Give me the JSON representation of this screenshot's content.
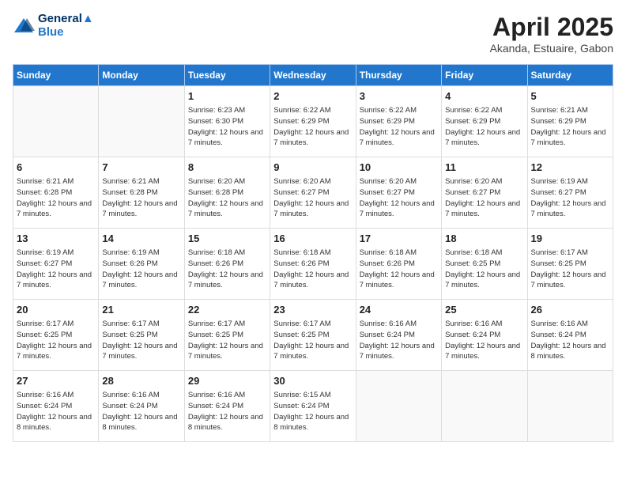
{
  "header": {
    "logo_line1": "General",
    "logo_line2": "Blue",
    "month_title": "April 2025",
    "location": "Akanda, Estuaire, Gabon"
  },
  "weekdays": [
    "Sunday",
    "Monday",
    "Tuesday",
    "Wednesday",
    "Thursday",
    "Friday",
    "Saturday"
  ],
  "weeks": [
    [
      {
        "day": "",
        "info": ""
      },
      {
        "day": "",
        "info": ""
      },
      {
        "day": "1",
        "info": "Sunrise: 6:23 AM\nSunset: 6:30 PM\nDaylight: 12 hours and 7 minutes."
      },
      {
        "day": "2",
        "info": "Sunrise: 6:22 AM\nSunset: 6:29 PM\nDaylight: 12 hours and 7 minutes."
      },
      {
        "day": "3",
        "info": "Sunrise: 6:22 AM\nSunset: 6:29 PM\nDaylight: 12 hours and 7 minutes."
      },
      {
        "day": "4",
        "info": "Sunrise: 6:22 AM\nSunset: 6:29 PM\nDaylight: 12 hours and 7 minutes."
      },
      {
        "day": "5",
        "info": "Sunrise: 6:21 AM\nSunset: 6:29 PM\nDaylight: 12 hours and 7 minutes."
      }
    ],
    [
      {
        "day": "6",
        "info": "Sunrise: 6:21 AM\nSunset: 6:28 PM\nDaylight: 12 hours and 7 minutes."
      },
      {
        "day": "7",
        "info": "Sunrise: 6:21 AM\nSunset: 6:28 PM\nDaylight: 12 hours and 7 minutes."
      },
      {
        "day": "8",
        "info": "Sunrise: 6:20 AM\nSunset: 6:28 PM\nDaylight: 12 hours and 7 minutes."
      },
      {
        "day": "9",
        "info": "Sunrise: 6:20 AM\nSunset: 6:27 PM\nDaylight: 12 hours and 7 minutes."
      },
      {
        "day": "10",
        "info": "Sunrise: 6:20 AM\nSunset: 6:27 PM\nDaylight: 12 hours and 7 minutes."
      },
      {
        "day": "11",
        "info": "Sunrise: 6:20 AM\nSunset: 6:27 PM\nDaylight: 12 hours and 7 minutes."
      },
      {
        "day": "12",
        "info": "Sunrise: 6:19 AM\nSunset: 6:27 PM\nDaylight: 12 hours and 7 minutes."
      }
    ],
    [
      {
        "day": "13",
        "info": "Sunrise: 6:19 AM\nSunset: 6:27 PM\nDaylight: 12 hours and 7 minutes."
      },
      {
        "day": "14",
        "info": "Sunrise: 6:19 AM\nSunset: 6:26 PM\nDaylight: 12 hours and 7 minutes."
      },
      {
        "day": "15",
        "info": "Sunrise: 6:18 AM\nSunset: 6:26 PM\nDaylight: 12 hours and 7 minutes."
      },
      {
        "day": "16",
        "info": "Sunrise: 6:18 AM\nSunset: 6:26 PM\nDaylight: 12 hours and 7 minutes."
      },
      {
        "day": "17",
        "info": "Sunrise: 6:18 AM\nSunset: 6:26 PM\nDaylight: 12 hours and 7 minutes."
      },
      {
        "day": "18",
        "info": "Sunrise: 6:18 AM\nSunset: 6:25 PM\nDaylight: 12 hours and 7 minutes."
      },
      {
        "day": "19",
        "info": "Sunrise: 6:17 AM\nSunset: 6:25 PM\nDaylight: 12 hours and 7 minutes."
      }
    ],
    [
      {
        "day": "20",
        "info": "Sunrise: 6:17 AM\nSunset: 6:25 PM\nDaylight: 12 hours and 7 minutes."
      },
      {
        "day": "21",
        "info": "Sunrise: 6:17 AM\nSunset: 6:25 PM\nDaylight: 12 hours and 7 minutes."
      },
      {
        "day": "22",
        "info": "Sunrise: 6:17 AM\nSunset: 6:25 PM\nDaylight: 12 hours and 7 minutes."
      },
      {
        "day": "23",
        "info": "Sunrise: 6:17 AM\nSunset: 6:25 PM\nDaylight: 12 hours and 7 minutes."
      },
      {
        "day": "24",
        "info": "Sunrise: 6:16 AM\nSunset: 6:24 PM\nDaylight: 12 hours and 7 minutes."
      },
      {
        "day": "25",
        "info": "Sunrise: 6:16 AM\nSunset: 6:24 PM\nDaylight: 12 hours and 7 minutes."
      },
      {
        "day": "26",
        "info": "Sunrise: 6:16 AM\nSunset: 6:24 PM\nDaylight: 12 hours and 8 minutes."
      }
    ],
    [
      {
        "day": "27",
        "info": "Sunrise: 6:16 AM\nSunset: 6:24 PM\nDaylight: 12 hours and 8 minutes."
      },
      {
        "day": "28",
        "info": "Sunrise: 6:16 AM\nSunset: 6:24 PM\nDaylight: 12 hours and 8 minutes."
      },
      {
        "day": "29",
        "info": "Sunrise: 6:16 AM\nSunset: 6:24 PM\nDaylight: 12 hours and 8 minutes."
      },
      {
        "day": "30",
        "info": "Sunrise: 6:15 AM\nSunset: 6:24 PM\nDaylight: 12 hours and 8 minutes."
      },
      {
        "day": "",
        "info": ""
      },
      {
        "day": "",
        "info": ""
      },
      {
        "day": "",
        "info": ""
      }
    ]
  ]
}
